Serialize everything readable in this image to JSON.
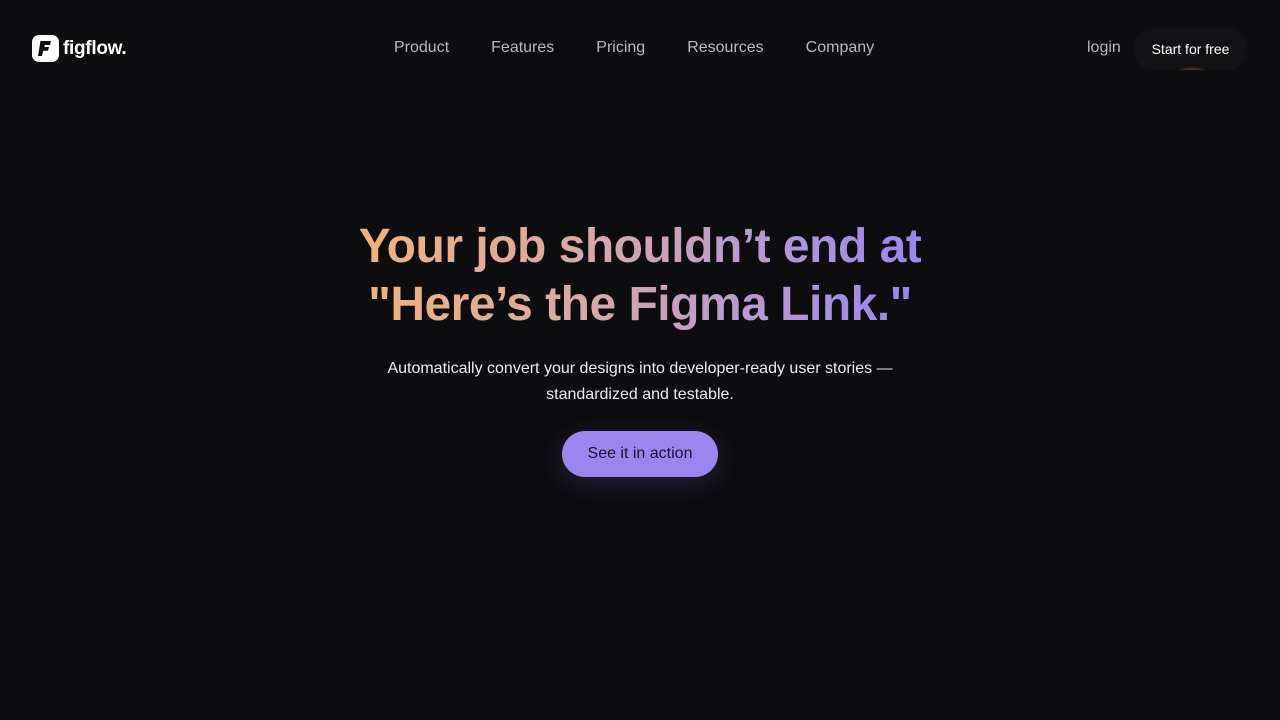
{
  "header": {
    "logo_text": "figflow.",
    "nav": [
      {
        "label": "Product"
      },
      {
        "label": "Features"
      },
      {
        "label": "Pricing"
      },
      {
        "label": "Resources"
      },
      {
        "label": "Company"
      }
    ],
    "login_label": "login",
    "start_label": "Start for free"
  },
  "hero": {
    "title_line1": "Your job shouldn’t end at",
    "title_line2": "\"Here’s the Figma Link.\"",
    "subtitle_line1": "Automatically convert your designs into developer-ready user stories —",
    "subtitle_line2": "standardized and testable.",
    "cta_label": "See it in action"
  },
  "colors": {
    "background": "#0d0d10",
    "accent": "#9b86f0",
    "gradient_start": "#f1b27a",
    "gradient_end": "#9a85ef",
    "nav_text": "#b8b8be"
  },
  "icons": {
    "logo": "figflow-logo-icon"
  }
}
